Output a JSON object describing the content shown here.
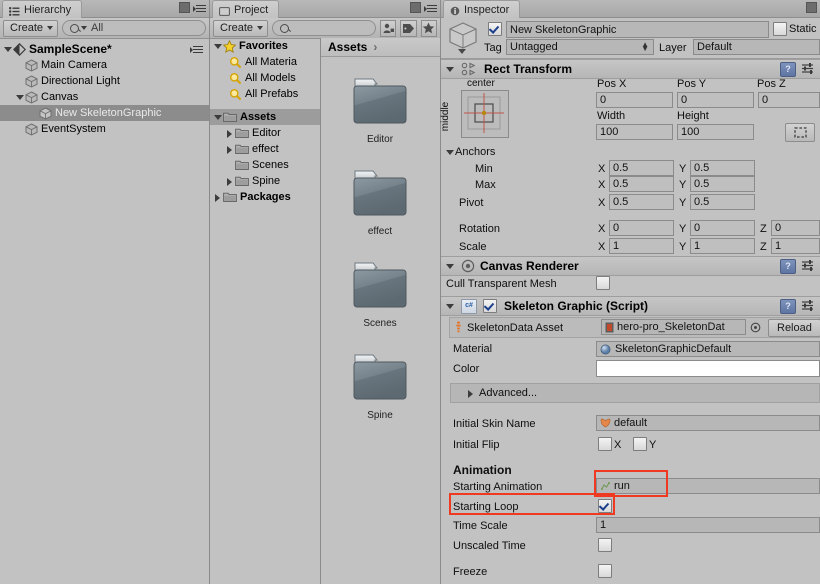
{
  "hierarchy": {
    "tab_label": "Hierarchy",
    "tab_icon": "hierarchy-icon",
    "create_label": "Create",
    "search_placeholder": "All",
    "scene_name": "SampleScene*",
    "items": [
      {
        "label": "Main Camera",
        "depth": 1,
        "expandable": false,
        "selected": false
      },
      {
        "label": "Directional Light",
        "depth": 1,
        "expandable": false,
        "selected": false
      },
      {
        "label": "Canvas",
        "depth": 1,
        "expandable": true,
        "selected": false
      },
      {
        "label": "New SkeletonGraphic",
        "depth": 2,
        "expandable": false,
        "selected": true
      },
      {
        "label": "EventSystem",
        "depth": 1,
        "expandable": false,
        "selected": false
      }
    ]
  },
  "project": {
    "tab_label": "Project",
    "create_label": "Create",
    "search_placeholder": "",
    "toolbar_icons": [
      "avatar-mask-icon",
      "label-tag-icon",
      "favorite-star-icon"
    ],
    "tree": [
      {
        "label": "Favorites",
        "icon": "star-icon",
        "depth": 0,
        "expandable": true,
        "bold": true
      },
      {
        "label": "All Materia",
        "icon": "search-icon",
        "depth": 1,
        "expandable": false,
        "bold": false
      },
      {
        "label": "All Models",
        "icon": "search-icon",
        "depth": 1,
        "expandable": false,
        "bold": false
      },
      {
        "label": "All Prefabs",
        "icon": "search-icon",
        "depth": 1,
        "expandable": false,
        "bold": false
      },
      {
        "label": "Assets",
        "icon": "folder-icon",
        "depth": 0,
        "expandable": true,
        "bold": true,
        "selected": true
      },
      {
        "label": "Editor",
        "icon": "folder-icon",
        "depth": 1,
        "expandable": true,
        "bold": false
      },
      {
        "label": "effect",
        "icon": "folder-icon",
        "depth": 1,
        "expandable": true,
        "bold": false
      },
      {
        "label": "Scenes",
        "icon": "folder-icon",
        "depth": 1,
        "expandable": false,
        "bold": false
      },
      {
        "label": "Spine",
        "icon": "folder-icon",
        "depth": 1,
        "expandable": true,
        "bold": false
      },
      {
        "label": "Packages",
        "icon": "folder-icon",
        "depth": 0,
        "expandable": true,
        "bold": true
      }
    ],
    "breadcrumb": "Assets",
    "breadcrumb_chevron": "›",
    "grid": [
      {
        "label": "Editor",
        "icon": "folder-icon"
      },
      {
        "label": "effect",
        "icon": "folder-icon"
      },
      {
        "label": "Scenes",
        "icon": "folder-icon"
      },
      {
        "label": "Spine",
        "icon": "folder-icon"
      }
    ]
  },
  "inspector": {
    "tab_label": "Inspector",
    "object_enabled": true,
    "object_name": "New SkeletonGraphic",
    "static_label": "Static",
    "static_checked": false,
    "tag_label": "Tag",
    "tag_value": "Untagged",
    "layer_label": "Layer",
    "layer_value": "Default",
    "rect_transform": {
      "title": "Rect Transform",
      "anchor_preset_h": "center",
      "anchor_preset_v": "middle",
      "pos_x_label": "Pos X",
      "pos_x": "0",
      "pos_y_label": "Pos Y",
      "pos_y": "0",
      "pos_z_label": "Pos Z",
      "pos_z": "0",
      "width_label": "Width",
      "width": "100",
      "height_label": "Height",
      "height": "100",
      "anchors_label": "Anchors",
      "min_label": "Min",
      "min_x": "0.5",
      "min_y": "0.5",
      "max_label": "Max",
      "max_x": "0.5",
      "max_y": "0.5",
      "pivot_label": "Pivot",
      "pivot_x": "0.5",
      "pivot_y": "0.5",
      "rotation_label": "Rotation",
      "rot_x": "0",
      "rot_y": "0",
      "rot_z": "0",
      "scale_label": "Scale",
      "scale_x": "1",
      "scale_y": "1",
      "scale_z": "1",
      "axis_x": "X",
      "axis_y": "Y",
      "axis_z": "Z"
    },
    "canvas_renderer": {
      "title": "Canvas Renderer",
      "cull_label": "Cull Transparent Mesh",
      "cull_checked": false
    },
    "skeleton_graphic": {
      "title": "Skeleton Graphic (Script)",
      "enabled": true,
      "script_badge": "c#",
      "skeletondata_label": "SkeletonData Asset",
      "skeletondata_value": "hero-pro_SkeletonDat",
      "reload_label": "Reload",
      "material_label": "Material",
      "material_value": "SkeletonGraphicDefault",
      "color_label": "Color",
      "color_value": "#FFFFFF",
      "advanced_label": "Advanced...",
      "initial_skin_label": "Initial Skin Name",
      "initial_skin_value": "default",
      "initial_flip_label": "Initial Flip",
      "flip_x_label": "X",
      "flip_x_checked": false,
      "flip_y_label": "Y",
      "flip_y_checked": false,
      "animation_header": "Animation",
      "starting_animation_label": "Starting Animation",
      "starting_animation_value": "run",
      "starting_loop_label": "Starting Loop",
      "starting_loop_checked": true,
      "time_scale_label": "Time Scale",
      "time_scale_value": "1",
      "unscaled_time_label": "Unscaled Time",
      "unscaled_time_checked": false,
      "freeze_label": "Freeze",
      "freeze_checked": false
    }
  },
  "highlights": {
    "color": "#EF3A21",
    "boxes": [
      "starting-animation-field",
      "starting-loop-row"
    ]
  }
}
